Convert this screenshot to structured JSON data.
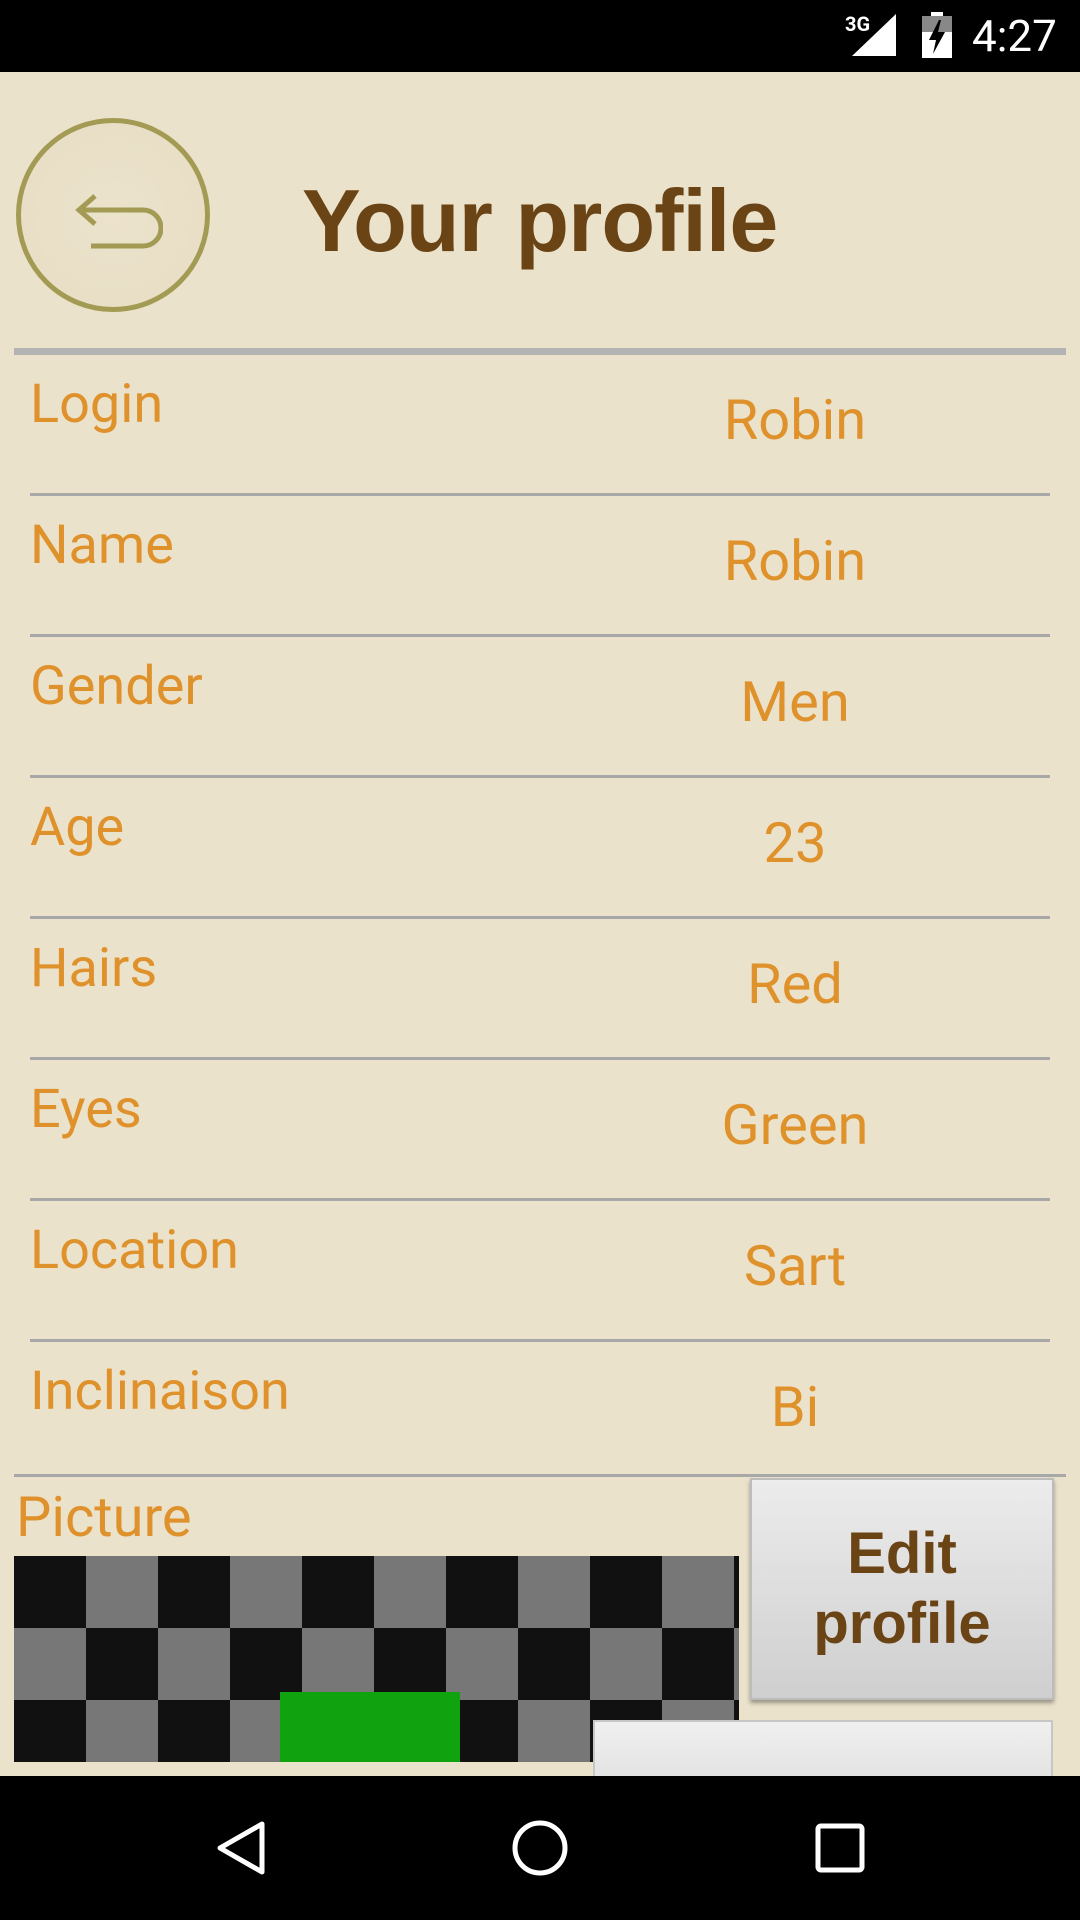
{
  "status_bar": {
    "network": "3G",
    "time": "4:27",
    "icons": [
      "signal-icon",
      "battery-charging-icon"
    ]
  },
  "header": {
    "title": "Your profile",
    "back_icon": "back-arrow-icon"
  },
  "profile_fields": [
    {
      "label": "Login",
      "value": "Robin"
    },
    {
      "label": "Name",
      "value": "Robin"
    },
    {
      "label": "Gender",
      "value": "Men"
    },
    {
      "label": "Age",
      "value": "23"
    },
    {
      "label": "Hairs",
      "value": "Red"
    },
    {
      "label": "Eyes",
      "value": "Green"
    },
    {
      "label": "Location",
      "value": "Sart"
    },
    {
      "label": "Inclinaison",
      "value": "Bi"
    }
  ],
  "picture": {
    "label": "Picture"
  },
  "actions": {
    "edit_profile_label": "Edit profile"
  },
  "nav_bar": {
    "icons": [
      "back-triangle-icon",
      "home-circle-icon",
      "recents-square-icon"
    ]
  },
  "colors": {
    "background": "#ebe2cc",
    "title": "#6b4416",
    "field_text": "#df922b",
    "back_ring": "#a39b53",
    "picture_green": "#10a20f"
  }
}
